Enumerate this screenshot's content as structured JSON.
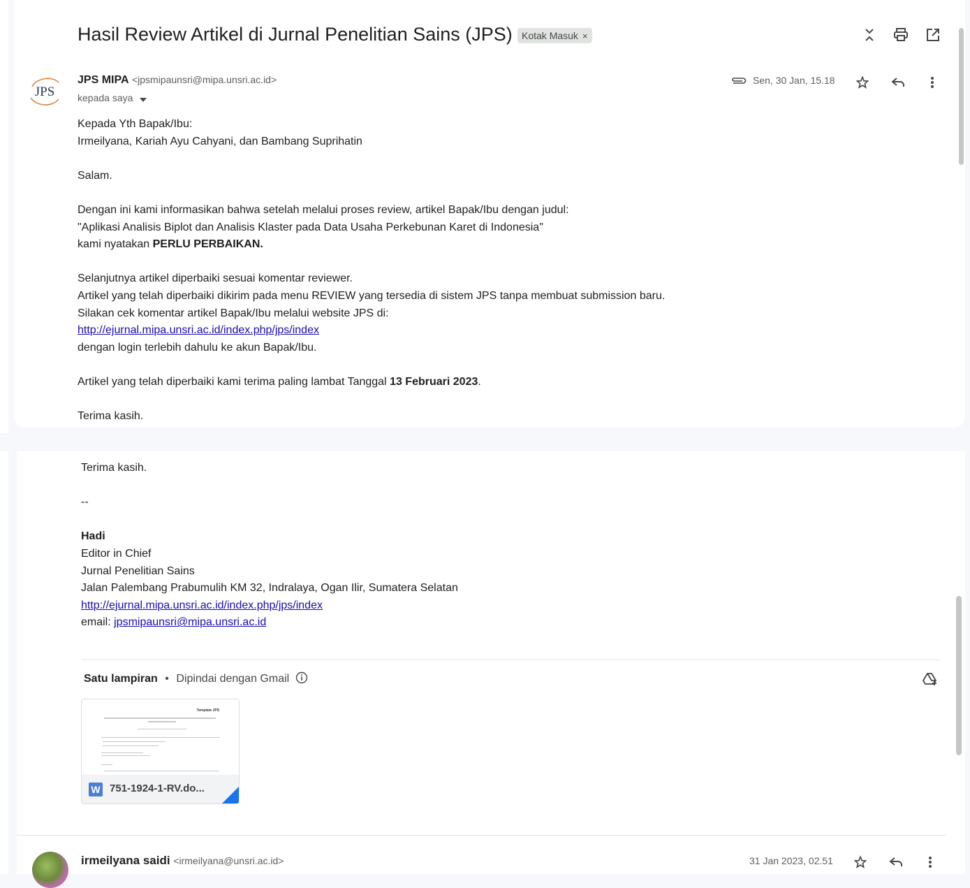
{
  "message": {
    "subject": "Hasil Review Artikel di Jurnal Penelitian Sains (JPS)",
    "label": "Kotak Masuk",
    "label_close": "×",
    "sender_name": "JPS MIPA",
    "sender_email": "<jpsmipaunsri@mipa.unsri.ac.id>",
    "to": "kepada saya",
    "date": "Sen, 30 Jan, 15.18",
    "avatar_text": "JPS",
    "body_top": {
      "greeting": "Kepada Yth Bapak/Ibu:",
      "recipients": "Irmeilyana, Kariah Ayu Cahyani, dan Bambang Suprihatin",
      "salam": "Salam.",
      "p1_line1": "Dengan ini kami informasikan bahwa setelah melalui proses review, artikel Bapak/Ibu dengan judul:",
      "p1_line2": "\"Aplikasi Analisis Biplot dan Analisis Klaster pada Data Usaha Perkebunan Karet di Indonesia\"",
      "p1_line3_pre": "kami nyatakan ",
      "p1_line3_bold": "PERLU PERBAIKAN.",
      "p2_line1": "Selanjutnya artikel diperbaiki sesuai komentar reviewer.",
      "p2_line2": "Artikel yang telah diperbaiki dikirim pada menu REVIEW yang tersedia di sistem JPS tanpa membuat submission baru.",
      "p2_line3": "Silakan cek komentar artikel Bapak/Ibu melalui website JPS di:",
      "p2_link": "http://ejurnal.mipa.unsri.ac.id/index.php/jps/index",
      "p2_line5": "dengan login terlebih dahulu ke akun Bapak/Ibu.",
      "p3_pre": "Artikel yang telah diperbaiki kami terima paling lambat Tanggal ",
      "p3_bold": "13 Februari 2023",
      "p3_post": ".",
      "thanks": "Terima kasih."
    },
    "body_bottom": {
      "thanks": "Terima kasih.",
      "sig_sep": "--",
      "sig_name": "Hadi",
      "sig_role": "Editor in Chief",
      "sig_org": "Jurnal Penelitian Sains",
      "sig_address": "Jalan Palembang Prabumulih KM 32, Indralaya, Ogan Ilir, Sumatera Selatan",
      "sig_link": "http://ejurnal.mipa.unsri.ac.id/index.php/jps/index",
      "sig_email_label": "email: ",
      "sig_email": "jpsmipaunsri@mipa.unsri.ac.id"
    },
    "attachments": {
      "count_label": "Satu lampiran",
      "bullet": "•",
      "scan_label": "Dipindai dengan Gmail",
      "file_name": "751-1924-1-RV.do...",
      "file_type_icon": "W",
      "thumb_header": "Template JPS"
    }
  },
  "reply": {
    "sender_name": "irmeilyana saidi",
    "sender_email": "<irmeilyana@unsri.ac.id>",
    "date": "31 Jan 2023, 02.51"
  },
  "icons": {
    "collapse": "collapse-all-icon",
    "print": "print-icon",
    "open_new": "open-in-new-window-icon",
    "attachment": "paperclip-icon",
    "star": "star-icon",
    "reply": "reply-icon",
    "more": "more-vert-icon",
    "add_to_drive": "add-to-drive-icon",
    "info": "info-icon",
    "dropdown": "chevron-down-icon"
  }
}
